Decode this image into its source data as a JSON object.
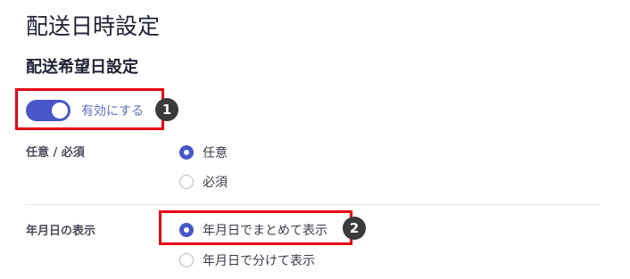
{
  "page_title": "配送日時設定",
  "section_title": "配送希望日設定",
  "toggle": {
    "label": "有効にする",
    "enabled": true
  },
  "badges": [
    "1",
    "2"
  ],
  "required_setting": {
    "label": "任意 / 必須",
    "options": [
      "任意",
      "必須"
    ],
    "selected": "任意"
  },
  "date_display": {
    "label": "年月日の表示",
    "options": [
      "年月日でまとめて表示",
      "年月日で分けて表示"
    ],
    "selected": "年月日でまとめて表示"
  },
  "colors": {
    "accent": "#4756c8",
    "highlight": "#e60012",
    "badge": "#3a3a3a"
  }
}
